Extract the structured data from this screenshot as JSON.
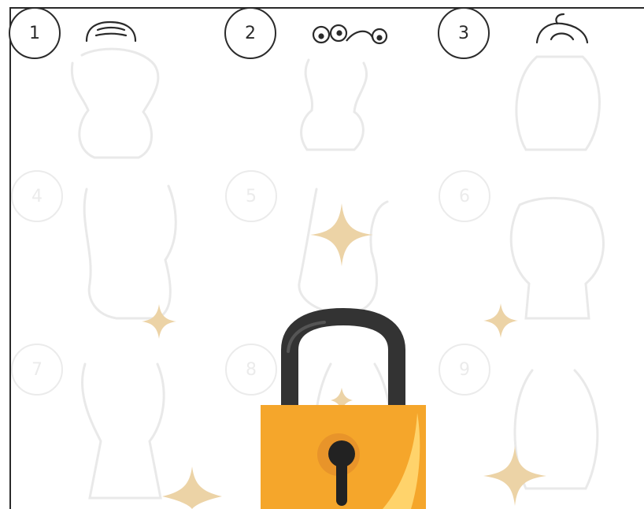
{
  "worksheet": {
    "cells": [
      {
        "number": "1",
        "state": "visible"
      },
      {
        "number": "2",
        "state": "visible"
      },
      {
        "number": "3",
        "state": "visible"
      },
      {
        "number": "4",
        "state": "faded"
      },
      {
        "number": "5",
        "state": "faded"
      },
      {
        "number": "6",
        "state": "faded"
      },
      {
        "number": "7",
        "state": "faded"
      },
      {
        "number": "8",
        "state": "faded"
      },
      {
        "number": "9",
        "state": "faded"
      }
    ]
  },
  "lock": {
    "icon": "padlock-icon",
    "shackle_color": "#333333",
    "body_color": "#f5a62b",
    "highlight_color": "#ffd36b",
    "keyhole_color": "#222222"
  },
  "sparkle_color": "#ecd3a6",
  "line_color": "#2a2a2a"
}
